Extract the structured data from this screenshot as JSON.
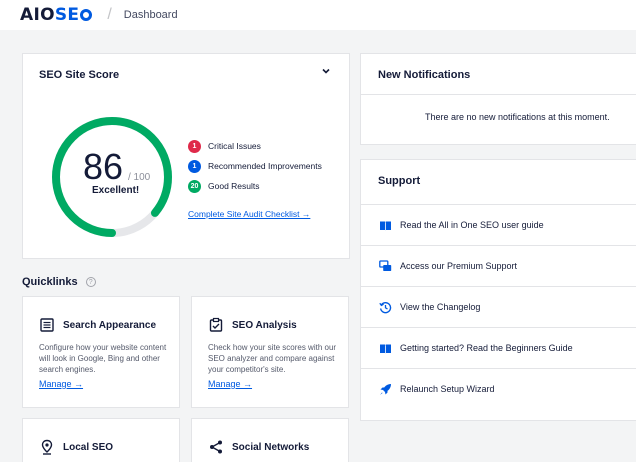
{
  "header": {
    "logo_prefix": "AIO",
    "logo_suffix_left": "S",
    "logo_suffix_right": "E",
    "breadcrumb": "Dashboard"
  },
  "score_card": {
    "title": "SEO Site Score",
    "score": "86",
    "max": "/ 100",
    "rating": "Excellent!",
    "score_fraction": 0.86,
    "legend": [
      {
        "count": "1",
        "label": "Critical Issues",
        "color": "#df2a4a"
      },
      {
        "count": "1",
        "label": "Recommended Improvements",
        "color": "#005ae0"
      },
      {
        "count": "20",
        "label": "Good Results",
        "color": "#00aa63"
      }
    ],
    "audit_link": "Complete Site Audit Checklist →"
  },
  "quicklinks": {
    "title": "Quicklinks",
    "help": "?",
    "items": [
      {
        "title": "Search Appearance",
        "desc": "Configure how your website content will look in Google, Bing and other search engines.",
        "link": "Manage →",
        "icon": "search-appearance-icon"
      },
      {
        "title": "SEO Analysis",
        "desc": "Check how your site scores with our SEO analyzer and compare against your competitor's site.",
        "link": "Manage →",
        "icon": "seo-analysis-icon"
      },
      {
        "title": "Local SEO",
        "icon": "location-pin-icon"
      },
      {
        "title": "Social Networks",
        "icon": "share-icon"
      }
    ]
  },
  "notifications": {
    "title": "New Notifications",
    "empty": "There are no new notifications at this moment."
  },
  "support": {
    "title": "Support",
    "items": [
      {
        "label": "Read the All in One SEO user guide",
        "icon": "book-icon"
      },
      {
        "label": "Access our Premium Support",
        "icon": "chat-icon"
      },
      {
        "label": "View the Changelog",
        "icon": "history-icon"
      },
      {
        "label": "Getting started? Read the Beginners Guide",
        "icon": "book-icon"
      },
      {
        "label": "Relaunch Setup Wizard",
        "icon": "rocket-icon"
      }
    ]
  },
  "colors": {
    "accent": "#005ae0",
    "success": "#00aa63",
    "danger": "#df2a4a",
    "text": "#141b38"
  }
}
